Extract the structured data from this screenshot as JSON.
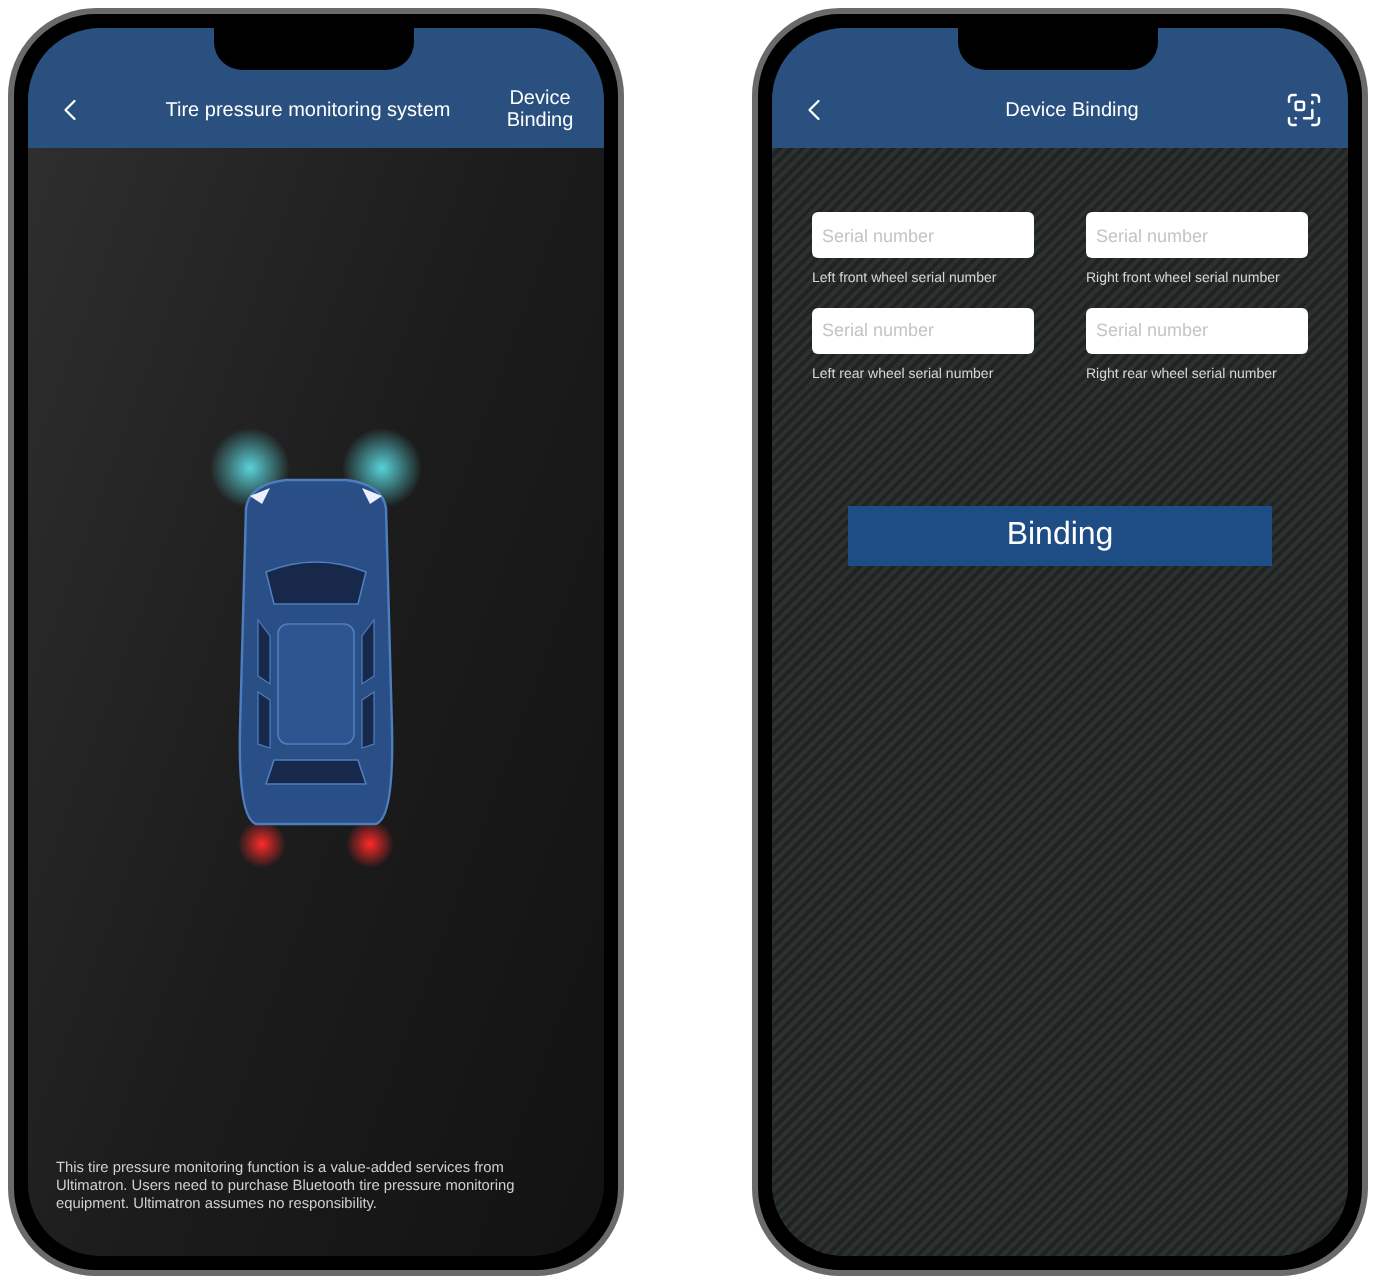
{
  "screens": [
    {
      "kind": "monitor",
      "title": "Tire pressure monitoring system",
      "action": "Device Binding",
      "disclaimer": "This tire pressure monitoring function is a value-added services from Ultimatron. Users need to purchase Bluetooth tire pressure monitoring equipment. Ultimatron assumes no responsibility."
    },
    {
      "kind": "binding",
      "title": "Device Binding",
      "fields": [
        {
          "placeholder": "Serial number",
          "label": "Left front wheel serial number"
        },
        {
          "placeholder": "Serial number",
          "label": "Right front wheel serial number"
        },
        {
          "placeholder": "Serial number",
          "label": "Left rear wheel serial number"
        },
        {
          "placeholder": "Serial number",
          "label": "Right rear wheel serial number"
        }
      ],
      "button": "Binding"
    }
  ]
}
